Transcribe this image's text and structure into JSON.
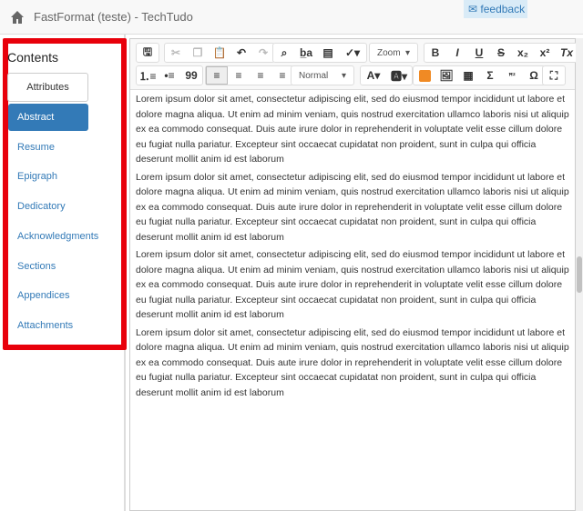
{
  "header": {
    "title": "FastFormat (teste) - TechTudo",
    "feedback": "feedback"
  },
  "sidebar": {
    "title": "Contents",
    "attributes": "Attributes",
    "items": [
      {
        "label": "Abstract",
        "active": true
      },
      {
        "label": "Resume"
      },
      {
        "label": "Epigraph"
      },
      {
        "label": "Dedicatory"
      },
      {
        "label": "Acknowledgments"
      },
      {
        "label": "Sections"
      },
      {
        "label": "Appendices"
      },
      {
        "label": "Attachments"
      }
    ]
  },
  "toolbar": {
    "zoom": "Zoom",
    "format": "Normal",
    "bold": "B",
    "italic": "I",
    "underline": "U",
    "strike": "S",
    "subscript": "x₂",
    "superscript": "x²",
    "clear": "Tx",
    "quote": "99",
    "sigma": "Σ",
    "omega": "Ω",
    "highlight_color": "#f08a24"
  },
  "content": {
    "paragraphs": [
      "Lorem ipsum dolor sit amet, consectetur adipiscing elit, sed do eiusmod tempor incididunt ut labore et dolore magna aliqua. Ut enim ad minim veniam, quis nostrud exercitation ullamco laboris nisi ut aliquip ex ea commodo consequat. Duis aute irure dolor in reprehenderit in voluptate velit esse cillum dolore eu fugiat nulla pariatur. Excepteur sint occaecat cupidatat non proident, sunt in culpa qui officia deserunt mollit anim id est laborum",
      "Lorem ipsum dolor sit amet, consectetur adipiscing elit, sed do eiusmod tempor incididunt ut labore et dolore magna aliqua. Ut enim ad minim veniam, quis nostrud exercitation ullamco laboris nisi ut aliquip ex ea commodo consequat. Duis aute irure dolor in reprehenderit in voluptate velit esse cillum dolore eu fugiat nulla pariatur. Excepteur sint occaecat cupidatat non proident, sunt in culpa qui officia deserunt mollit anim id est laborum",
      "Lorem ipsum dolor sit amet, consectetur adipiscing elit, sed do eiusmod tempor incididunt ut labore et dolore magna aliqua. Ut enim ad minim veniam, quis nostrud exercitation ullamco laboris nisi ut aliquip ex ea commodo consequat. Duis aute irure dolor in reprehenderit in voluptate velit esse cillum dolore eu fugiat nulla pariatur. Excepteur sint occaecat cupidatat non proident, sunt in culpa qui officia deserunt mollit anim id est laborum",
      "Lorem ipsum dolor sit amet, consectetur adipiscing elit, sed do eiusmod tempor incididunt ut labore et dolore magna aliqua. Ut enim ad minim veniam, quis nostrud exercitation ullamco laboris nisi ut aliquip ex ea commodo consequat. Duis aute irure dolor in reprehenderit in voluptate velit esse cillum dolore eu fugiat nulla pariatur. Excepteur sint occaecat cupidatat non proident, sunt in culpa qui officia deserunt mollit anim id est laborum"
    ]
  }
}
